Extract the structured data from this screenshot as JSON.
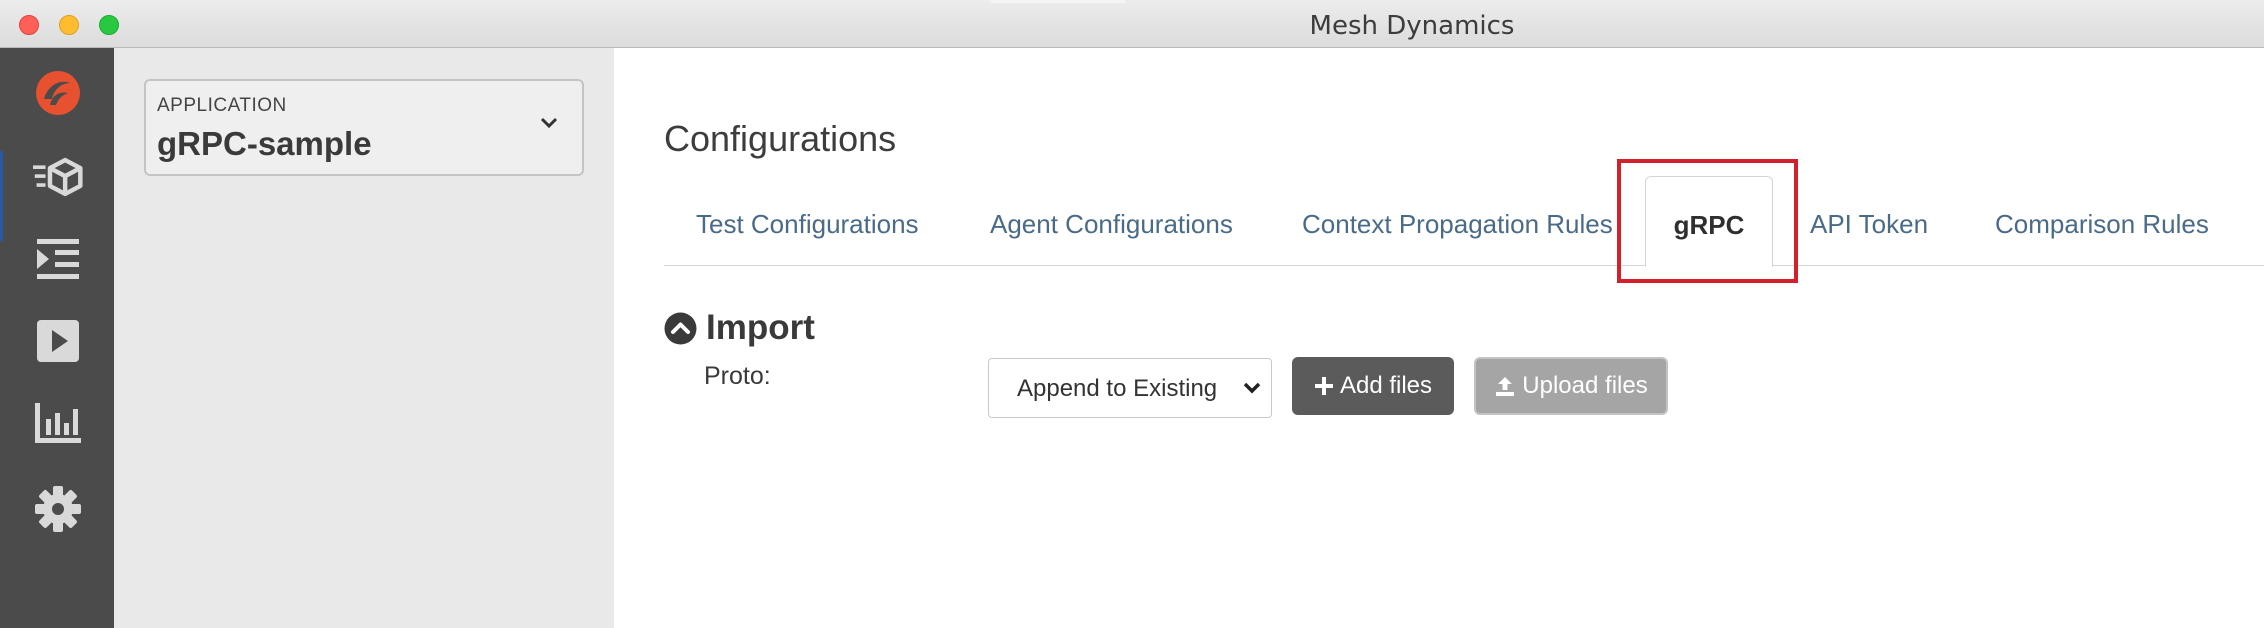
{
  "window": {
    "title": "Mesh Dynamics"
  },
  "nav": {
    "items": [
      {
        "icon": "logo-icon"
      },
      {
        "icon": "test-suite-icon"
      },
      {
        "icon": "list-indent-icon"
      },
      {
        "icon": "play-icon"
      },
      {
        "icon": "bar-chart-icon"
      },
      {
        "icon": "gear-icon"
      }
    ],
    "accent_color": "#2a56a8",
    "logo_color": "#e8512f"
  },
  "sidebar": {
    "application_label": "APPLICATION",
    "application_value": "gRPC-sample"
  },
  "main": {
    "title": "Configurations",
    "tabs": [
      {
        "label": "Test Configurations"
      },
      {
        "label": "Agent Configurations"
      },
      {
        "label": "Context Propagation Rules"
      },
      {
        "label": "gRPC",
        "active": true
      },
      {
        "label": "API Token"
      },
      {
        "label": "Comparison Rules"
      }
    ],
    "highlight_color": "#d4202b",
    "import": {
      "title": "Import",
      "proto_label": "Proto:",
      "mode_value": "Append to Existing",
      "add_files_label": "Add files",
      "upload_files_label": "Upload files"
    }
  }
}
